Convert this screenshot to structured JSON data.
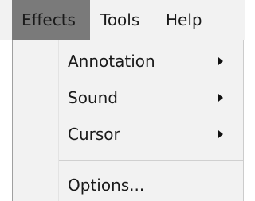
{
  "menubar": {
    "items": [
      {
        "label": "Effects",
        "active": true
      },
      {
        "label": "Tools",
        "active": false
      },
      {
        "label": "Help",
        "active": false
      }
    ]
  },
  "dropdown": {
    "items": [
      {
        "label": "Annotation",
        "has_submenu": true
      },
      {
        "label": "Sound",
        "has_submenu": true
      },
      {
        "label": "Cursor",
        "has_submenu": true
      },
      {
        "label": "Options...",
        "has_submenu": false
      }
    ]
  },
  "colors": {
    "menubar_bg": "#f2f2f2",
    "active_menu_bg": "#7a7a7a",
    "text": "#1a1a1a"
  }
}
